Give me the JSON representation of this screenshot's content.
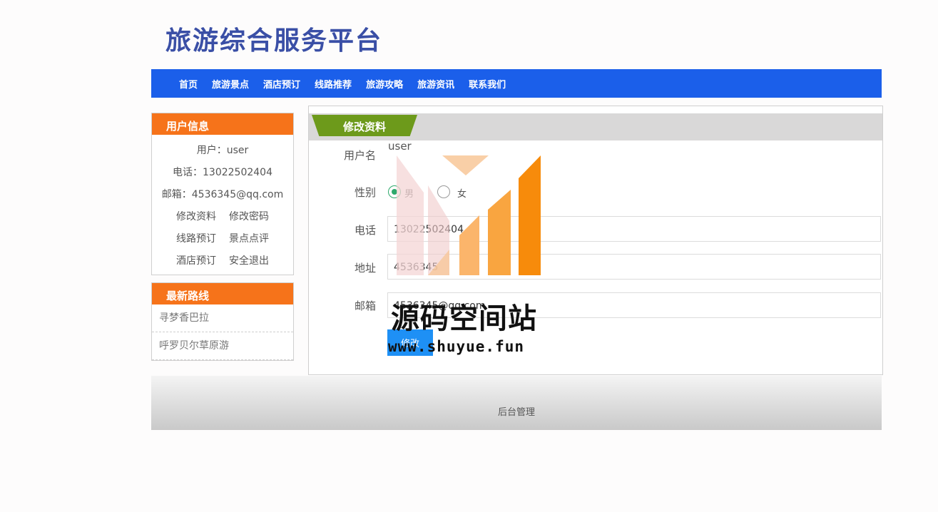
{
  "site": {
    "title": "旅游综合服务平台"
  },
  "nav": {
    "items": [
      "首页",
      "旅游景点",
      "酒店预订",
      "线路推荐",
      "旅游攻略",
      "旅游资讯",
      "联系我们"
    ]
  },
  "user_panel": {
    "title": "用户信息",
    "user": "用户：user",
    "phone": "电话：13022502404",
    "email": "邮箱：4536345@qq.com",
    "links": [
      "修改资料",
      "修改密码",
      "线路预订",
      "景点点评",
      "酒店预订",
      "安全退出"
    ]
  },
  "routes_panel": {
    "title": "最新路线",
    "items": [
      "寻梦香巴拉",
      "呼罗贝尔草原游"
    ]
  },
  "profile_form": {
    "tab_label": "修改资料",
    "username_label": "用户名",
    "username_value": "user",
    "gender_label": "性别",
    "gender_options": [
      "男",
      "女"
    ],
    "gender_selected": "男",
    "phone_label": "电话",
    "phone_value": "13022502404",
    "address_label": "地址",
    "address_value": "4536345",
    "email_label": "邮箱",
    "email_value": "4536345@qq.com",
    "submit_label": "修改"
  },
  "footer": {
    "admin_link": "后台管理"
  },
  "watermark": {
    "name": "源码空间站",
    "url": "www.shuyue.fun"
  },
  "colors": {
    "nav_bg": "#1b5fea",
    "panel_head": "#f6731a",
    "tab_green": "#6d9a1b",
    "title": "#3a4fa6",
    "button": "#1e90f5"
  }
}
